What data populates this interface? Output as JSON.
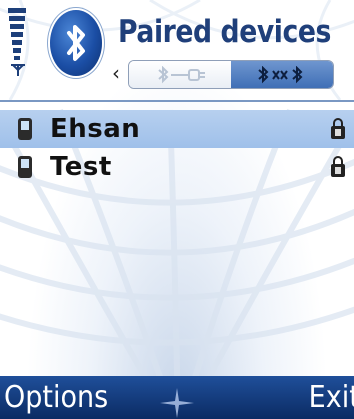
{
  "header": {
    "title": "Paired devices",
    "icon": "bluetooth-icon",
    "tabs": [
      {
        "icon": "bluetooth-connect-icon",
        "active": false
      },
      {
        "icon": "bluetooth-paired-icon",
        "active": true
      }
    ]
  },
  "devices": [
    {
      "name": "Ehsan",
      "icon": "phone-icon",
      "status_icon": "authorized-icon",
      "selected": true
    },
    {
      "name": "Test",
      "icon": "phone-icon",
      "status_icon": "authorized-icon",
      "selected": false
    }
  ],
  "softkeys": {
    "left": "Options",
    "right": "Exit"
  },
  "colors": {
    "accent": "#1b4ea5",
    "selection": "#a9c7ec",
    "softkey_bar": "#123a7c",
    "title": "#1f3f7a"
  }
}
